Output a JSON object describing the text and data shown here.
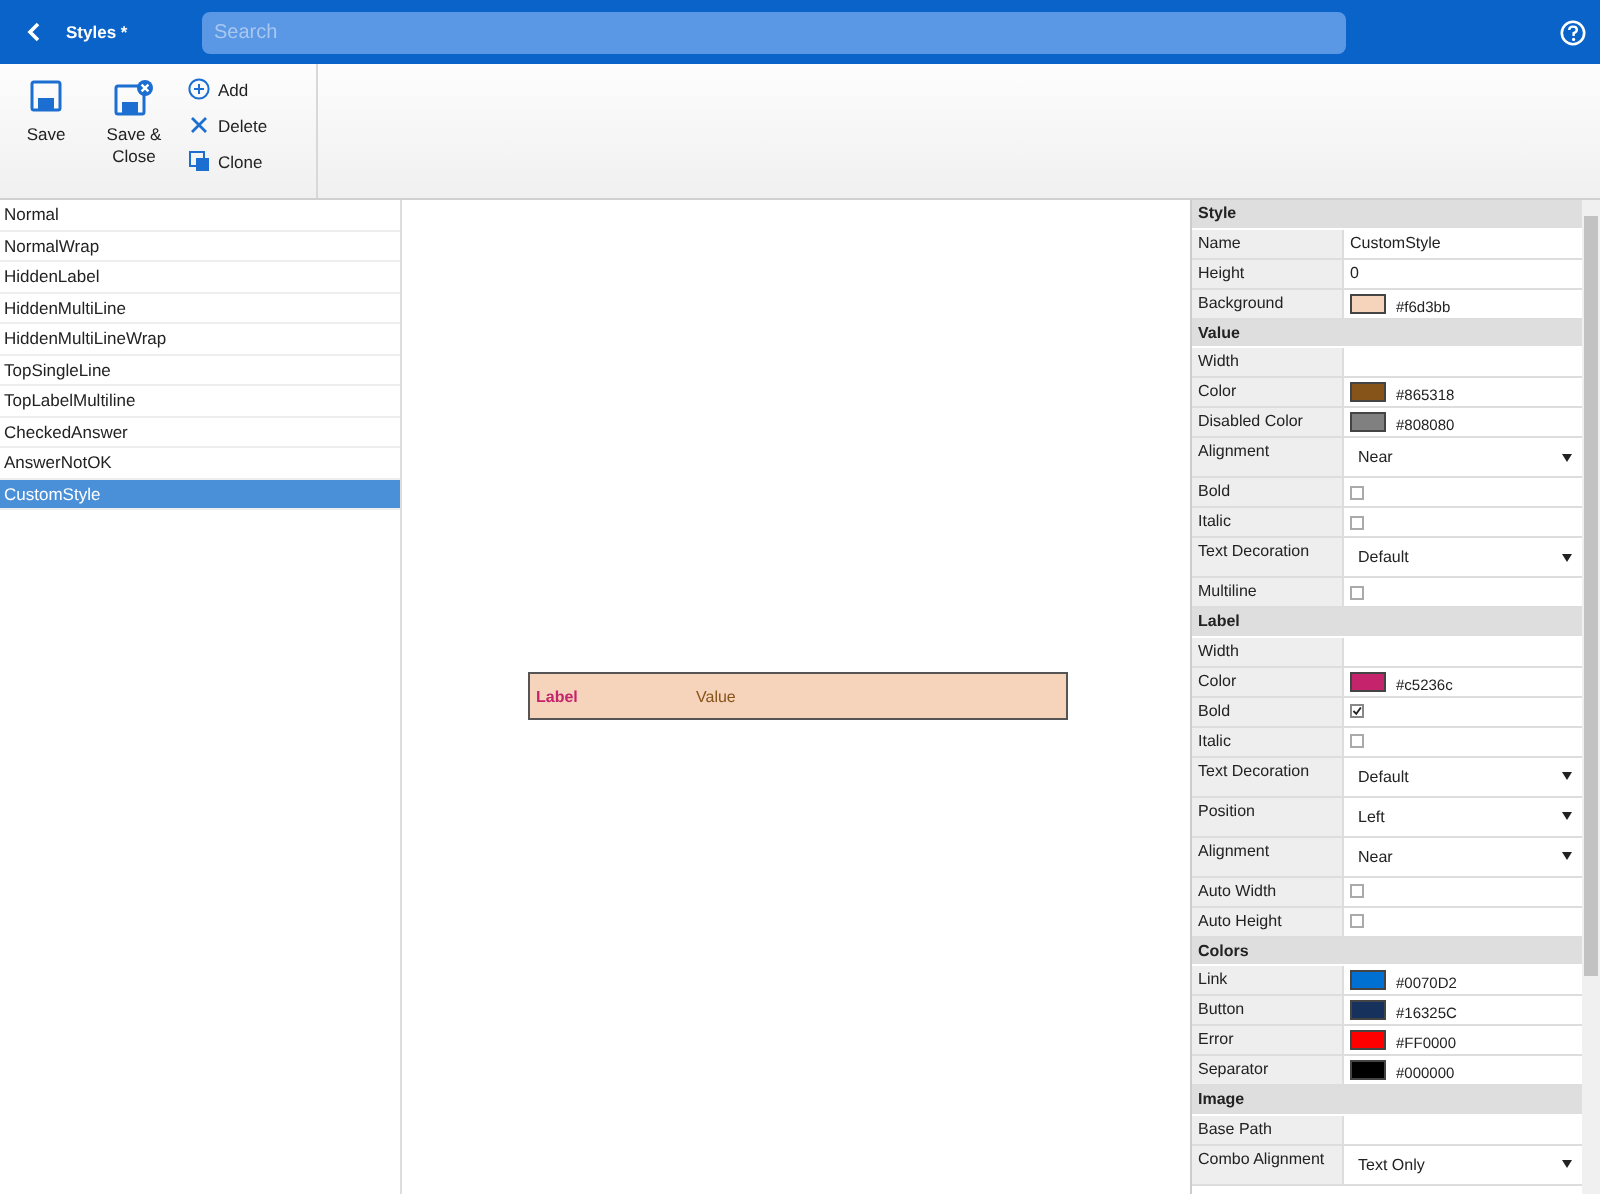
{
  "header": {
    "title": "Styles *",
    "search_placeholder": "Search"
  },
  "toolbar": {
    "large": [
      {
        "kind": "save",
        "label": "Save"
      },
      {
        "kind": "saveclose",
        "label": "Save & Close"
      }
    ],
    "small": [
      {
        "kind": "add",
        "label": "Add"
      },
      {
        "kind": "delete",
        "label": "Delete"
      },
      {
        "kind": "clone",
        "label": "Clone"
      }
    ]
  },
  "styles": [
    {
      "label": "Normal",
      "selected": false
    },
    {
      "label": "NormalWrap",
      "selected": false
    },
    {
      "label": "HiddenLabel",
      "selected": false
    },
    {
      "label": "HiddenMultiLine",
      "selected": false
    },
    {
      "label": "HiddenMultiLineWrap",
      "selected": false
    },
    {
      "label": "TopSingleLine",
      "selected": false
    },
    {
      "label": "TopLabelMultiline",
      "selected": false
    },
    {
      "label": "CheckedAnswer",
      "selected": false
    },
    {
      "label": "AnswerNotOK",
      "selected": false
    },
    {
      "label": "CustomStyle",
      "selected": true
    }
  ],
  "preview": {
    "label": "Label",
    "value": "Value"
  },
  "properties": [
    {
      "title": "Style",
      "rows": [
        {
          "kind": "text",
          "label": "Name",
          "value": "CustomStyle"
        },
        {
          "kind": "text",
          "label": "Height",
          "value": "0"
        },
        {
          "kind": "color",
          "label": "Background",
          "color": "#f6d3bb",
          "value": "#f6d3bb"
        }
      ]
    },
    {
      "title": "Value",
      "rows": [
        {
          "kind": "text",
          "label": "Width"
        },
        {
          "kind": "color",
          "label": "Color",
          "color": "#865318",
          "value": "#865318"
        },
        {
          "kind": "color",
          "label": "Disabled Color",
          "color": "#808080",
          "value": "#808080"
        },
        {
          "kind": "select",
          "label": "Alignment",
          "value": "Near"
        },
        {
          "kind": "check",
          "label": "Bold",
          "checked": false
        },
        {
          "kind": "check",
          "label": "Italic",
          "checked": false
        },
        {
          "kind": "select",
          "label": "Text Decoration",
          "value": "Default"
        },
        {
          "kind": "check",
          "label": "Multiline",
          "checked": false
        }
      ]
    },
    {
      "title": "Label",
      "rows": [
        {
          "kind": "text",
          "label": "Width"
        },
        {
          "kind": "color",
          "label": "Color",
          "color": "#c5236c",
          "value": "#c5236c"
        },
        {
          "kind": "check",
          "label": "Bold",
          "checked": true
        },
        {
          "kind": "check",
          "label": "Italic",
          "checked": false
        },
        {
          "kind": "select",
          "label": "Text Decoration",
          "value": "Default"
        },
        {
          "kind": "select",
          "label": "Position",
          "value": "Left"
        },
        {
          "kind": "select",
          "label": "Alignment",
          "value": "Near"
        },
        {
          "kind": "check",
          "label": "Auto Width",
          "checked": false
        },
        {
          "kind": "check",
          "label": "Auto Height",
          "checked": false
        }
      ]
    },
    {
      "title": "Colors",
      "rows": [
        {
          "kind": "color",
          "label": "Link",
          "color": "#0070d2",
          "value": "#0070D2"
        },
        {
          "kind": "color",
          "label": "Button",
          "color": "#16325c",
          "value": "#16325C"
        },
        {
          "kind": "color",
          "label": "Error",
          "color": "#ff0000",
          "value": "#FF0000"
        },
        {
          "kind": "color",
          "label": "Separator",
          "color": "#000000",
          "value": "#000000"
        }
      ]
    },
    {
      "title": "Image",
      "rows": [
        {
          "kind": "text",
          "label": "Base Path"
        },
        {
          "kind": "select",
          "label": "Combo Alignment",
          "value": "Text Only"
        }
      ]
    }
  ]
}
